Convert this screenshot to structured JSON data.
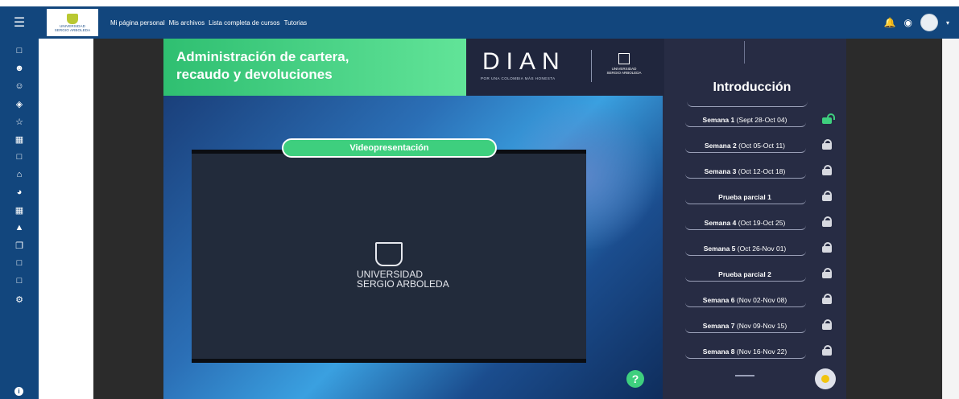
{
  "navbar": {
    "menu_icon": "hamburger-icon",
    "logo_line1": "UNIVERSIDAD",
    "logo_line2": "SERGIO ARBOLEDA",
    "links": [
      "Mi página personal",
      "Mis archivos",
      "Lista completa de cursos",
      "Tutorias"
    ],
    "icons": [
      "bell-icon",
      "chat-icon",
      "avatar",
      "caret-down-icon"
    ]
  },
  "sidebar": {
    "items": [
      "folder-icon",
      "users-icon",
      "user-badge-icon",
      "layers-icon",
      "star-icon",
      "book-icon",
      "folder-icon",
      "home-icon",
      "dashboard-icon",
      "calendar-icon",
      "graduation-cap-icon",
      "copy-icon",
      "folder-icon",
      "folder-icon",
      "gear-icon"
    ],
    "info": "i"
  },
  "course": {
    "banner_title_line1": "Administración de cartera,",
    "banner_title_line2": "recaudo y devoluciones",
    "dian_logo": "DIAN",
    "dian_slogan": "POR UNA COLOMBIA MÁS HONESTA",
    "usa_line1": "UNIVERSIDAD",
    "usa_line2": "SERGIO ARBOLEDA",
    "video_label": "Videopresentación",
    "video_logo_line1": "UNIVERSIDAD",
    "video_logo_line2": "SERGIO ARBOLEDA",
    "help_label": "?"
  },
  "menu": {
    "title": "Introducción",
    "items": [
      {
        "label": "Semana 1",
        "dates": "(Sept 28-Oct 04)",
        "status": "unlocked"
      },
      {
        "label": "Semana 2",
        "dates": "(Oct 05-Oct 11)",
        "status": "locked"
      },
      {
        "label": "Semana 3",
        "dates": "(Oct 12-Oct 18)",
        "status": "locked"
      },
      {
        "label": "Prueba parcial 1",
        "dates": "",
        "status": "locked"
      },
      {
        "label": "Semana 4",
        "dates": "(Oct 19-Oct 25)",
        "status": "locked"
      },
      {
        "label": "Semana 5",
        "dates": "(Oct 26-Nov 01)",
        "status": "locked"
      },
      {
        "label": "Prueba parcial 2",
        "dates": "",
        "status": "locked"
      },
      {
        "label": "Semana 6",
        "dates": "(Nov 02-Nov 08)",
        "status": "locked"
      },
      {
        "label": "Semana 7",
        "dates": "(Nov 09-Nov 15)",
        "status": "locked"
      },
      {
        "label": "Semana 8",
        "dates": "(Nov 16-Nov 22)",
        "status": "locked"
      }
    ]
  },
  "colors": {
    "navbar": "#12467d",
    "accent_green": "#3ecf7e",
    "panel_dark": "#272c44"
  }
}
